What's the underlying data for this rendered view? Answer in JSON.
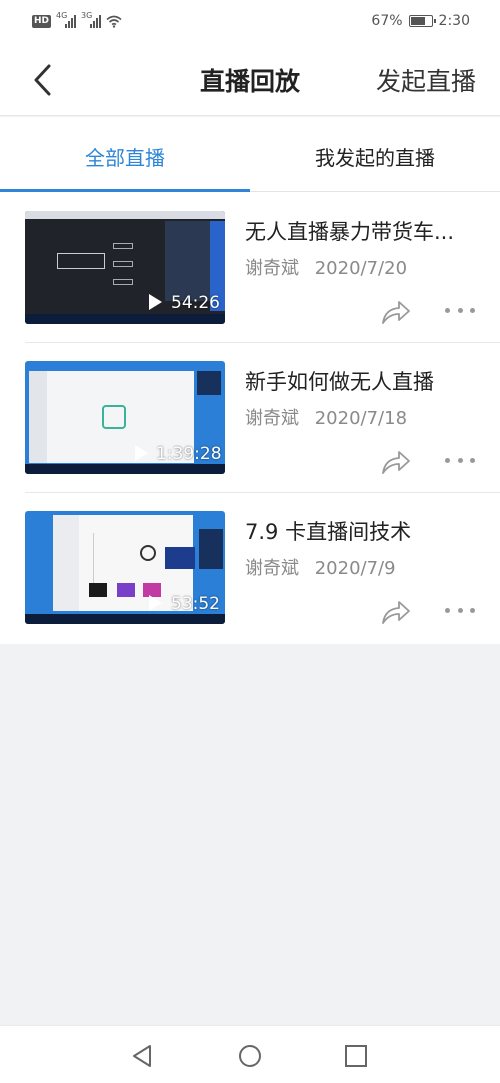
{
  "status": {
    "hd": "HD",
    "net1": "4G",
    "net2": "3G",
    "battery": "67%",
    "battery_level": 0.67,
    "time": "2:30"
  },
  "header": {
    "title": "直播回放",
    "action": "发起直播"
  },
  "tabs": [
    {
      "label": "全部直播",
      "active": true
    },
    {
      "label": "我发起的直播",
      "active": false
    }
  ],
  "items": [
    {
      "title": "无人直播暴力带货车...",
      "author": "谢奇斌",
      "date": "2020/7/20",
      "duration": "54:26",
      "thumb_theme": "dark"
    },
    {
      "title": "新手如何做无人直播",
      "author": "谢奇斌",
      "date": "2020/7/18",
      "duration": "1:39:28",
      "thumb_theme": "desktop-blue"
    },
    {
      "title": "7.9 卡直播间技术",
      "author": "谢奇斌",
      "date": "2020/7/9",
      "duration": "53:52",
      "thumb_theme": "desktop-blue"
    }
  ],
  "colors": {
    "accent": "#2f86d8",
    "background": "#f1f2f4"
  }
}
